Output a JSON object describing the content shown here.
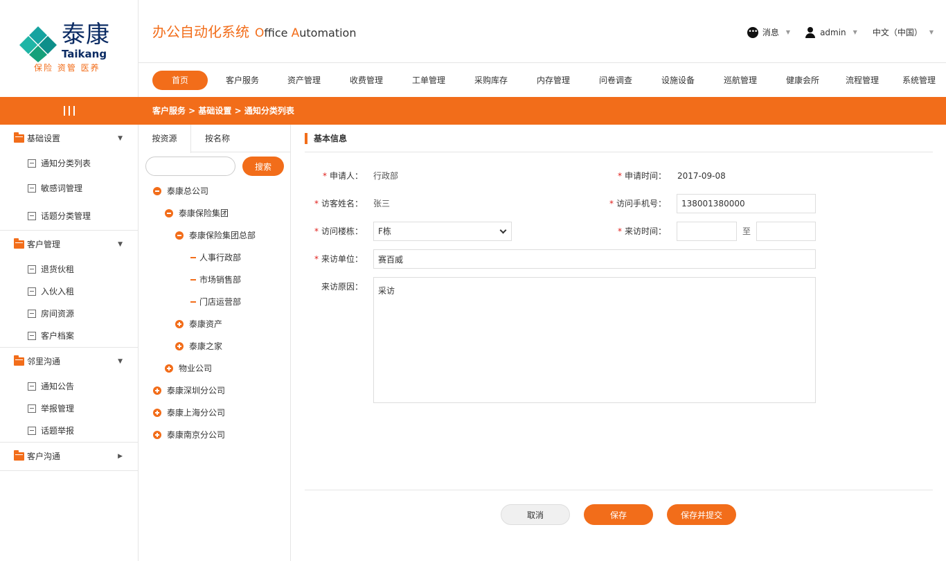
{
  "logo": {
    "cn": "泰康",
    "en": "Taikang",
    "slogan": "保险 资管 医养"
  },
  "header": {
    "title_cn": "办公自动化系统",
    "title_en_o": "O",
    "title_en_ffice": "ffice ",
    "title_en_a": "A",
    "title_en_utomation": "utomation",
    "messages": "消息",
    "user": "admin",
    "language": "中文（中国）"
  },
  "nav": [
    "首页",
    "客户服务",
    "资产管理",
    "收费管理",
    "工单管理",
    "采购库存",
    "内存管理",
    "问卷调查",
    "设施设备",
    "巡航管理",
    "健康会所",
    "流程管理",
    "系统管理"
  ],
  "breadcrumb": "客户服务 > 基础设置 > 通知分类列表",
  "sidebar": {
    "groups": [
      {
        "label": "基础设置",
        "arrow": "▼",
        "items": [
          "通知分类列表",
          "敏感词管理",
          "话题分类管理"
        ]
      },
      {
        "label": "客户管理",
        "arrow": "▼",
        "items": [
          "退货伙租",
          "入伙入租",
          "房间资源",
          "客户档案"
        ]
      },
      {
        "label": "邻里沟通",
        "arrow": "▼",
        "items": [
          "通知公告",
          "举报管理",
          "话题举报"
        ]
      },
      {
        "label": "客户沟通",
        "arrow": "▶",
        "items": []
      }
    ]
  },
  "tree": {
    "tabs": [
      "按资源",
      "按名称"
    ],
    "search_placeholder": "",
    "search_button": "搜索",
    "nodes": [
      "泰康总公司",
      "泰康保险集团",
      "泰康保险集团总部",
      "人事行政部",
      "市场销售部",
      "门店运营部",
      "泰康资产",
      "泰康之家",
      "物业公司",
      "泰康深圳分公司",
      "泰康上海分公司",
      "泰康南京分公司"
    ]
  },
  "form": {
    "section_title": "基本信息",
    "applicant_label": "申请人：",
    "applicant_value": "行政部",
    "apply_time_label": "申请时间：",
    "apply_time_value": "2017-09-08",
    "visitor_name_label": "访客姓名：",
    "visitor_name_value": "张三",
    "visitor_phone_label": "访问手机号：",
    "visitor_phone_value": "138001380000",
    "building_label": "访问楼栋：",
    "building_value": "F栋",
    "visit_time_label": "来访时间：",
    "visit_time_sep": "至",
    "visit_time_from": "",
    "visit_time_to": "",
    "unit_label": "来访单位：",
    "unit_value": "赛百威",
    "reason_label": "来访原因：",
    "reason_value": "采访"
  },
  "buttons": {
    "cancel": "取消",
    "save": "保存",
    "save_submit": "保存并提交"
  },
  "colors": {
    "accent": "#f26d1a",
    "required": "#e0201c",
    "logo_navy": "#0b2b63",
    "logo_teal": "#16a3a0"
  }
}
